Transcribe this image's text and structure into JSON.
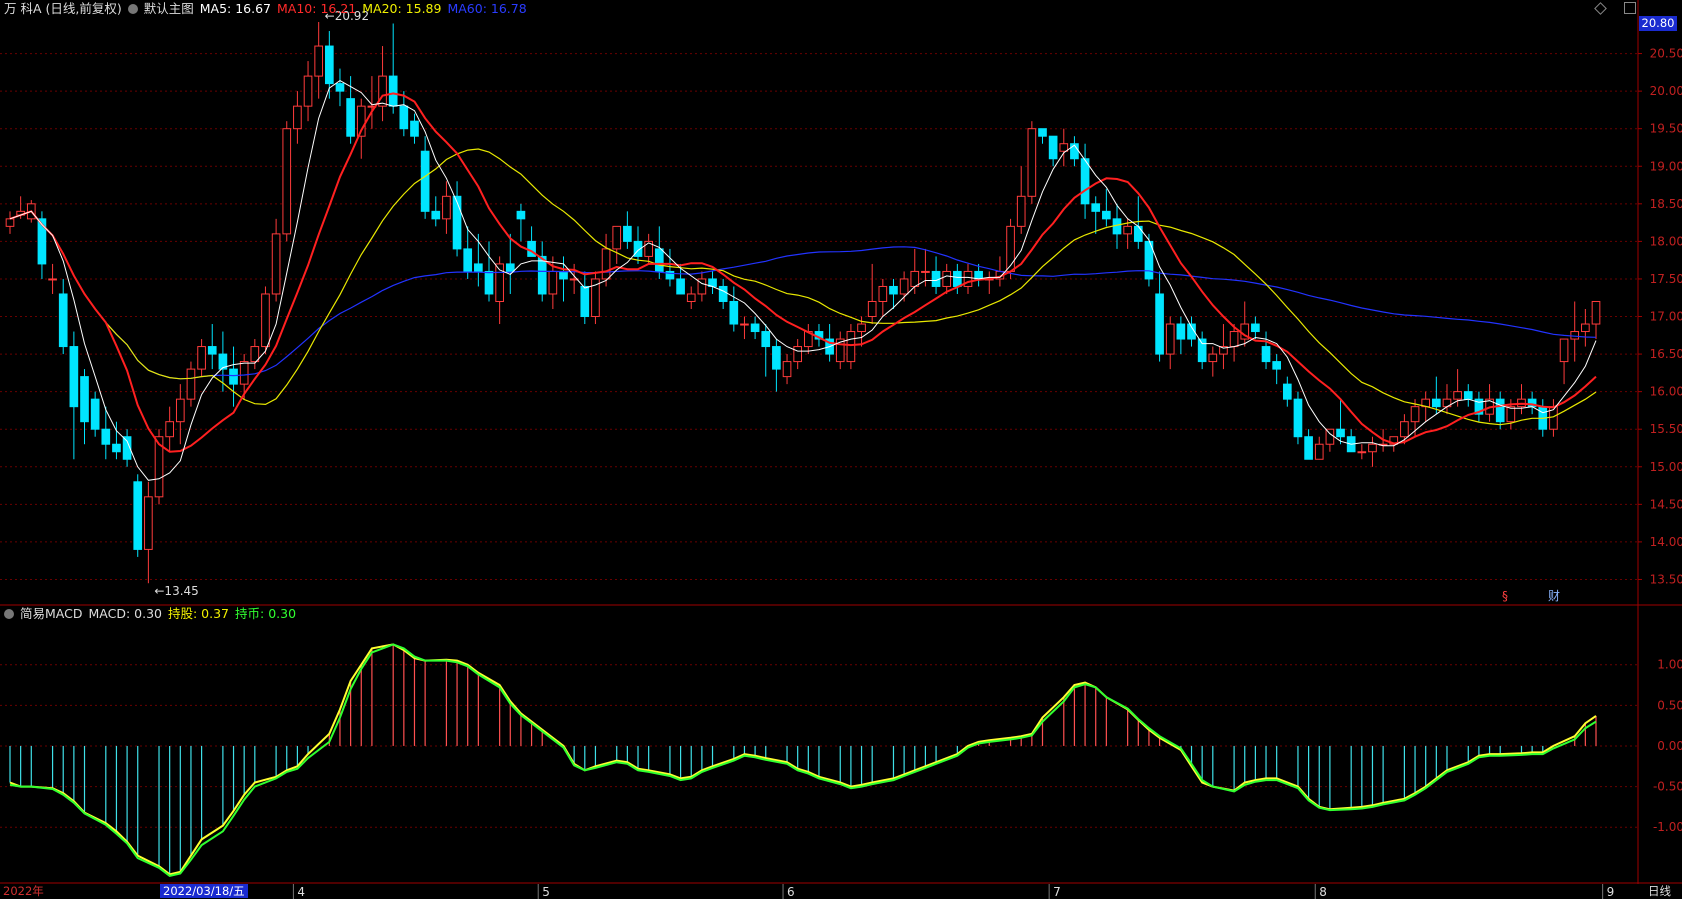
{
  "header": {
    "stock": "万 科A (日线,前复权)",
    "main_chart": "默认主图",
    "ma5": "MA5: 16.67",
    "ma10": "MA10: 16.21",
    "ma20": "MA20: 15.89",
    "ma60": "MA60: 16.78"
  },
  "macd_header": {
    "name": "简易MACD",
    "macd": "MACD: 0.30",
    "hold": "持股: 0.37",
    "coin": "持币: 0.30"
  },
  "price_box": "20.80",
  "selected_date": "2022/03/18/五",
  "year_label": "2022年",
  "period_label": "日线",
  "markers": {
    "s": "§",
    "cai": "财"
  },
  "colors": {
    "up": "#ff3b3b",
    "down": "#00e5ff",
    "ma5": "#ffffff",
    "ma10": "#ff2020",
    "ma20": "#e8e800",
    "ma60": "#2233ff",
    "macd_line": "#ffff30",
    "signal_line": "#30ff30",
    "axis": "#a00000",
    "grid": "#6a0000"
  },
  "chart_data": [
    {
      "type": "candlestick",
      "title": "万 科A (日线,前复权)",
      "ylim": [
        13.2,
        21.0
      ],
      "y_ticks": [
        13.5,
        14.0,
        14.5,
        15.0,
        15.5,
        16.0,
        16.5,
        17.0,
        17.5,
        18.0,
        18.5,
        19.0,
        19.5,
        20.0,
        20.5
      ],
      "y_tick_labels": [
        "13.50",
        "14.00",
        "14.50",
        "15.00",
        "15.50",
        "16.00",
        "16.50",
        "17.00",
        "17.50",
        "18.00",
        "18.50",
        "19.00",
        "19.50",
        "20.00",
        "20.50"
      ],
      "x_month_labels": [
        {
          "label": "4",
          "index": 27
        },
        {
          "label": "5",
          "index": 50
        },
        {
          "label": "6",
          "index": 73
        },
        {
          "label": "7",
          "index": 98
        },
        {
          "label": "8",
          "index": 123
        },
        {
          "label": "9",
          "index": 150
        }
      ],
      "annotations": [
        {
          "text": "20.92",
          "index": 29,
          "value": 20.92,
          "kind": "high"
        },
        {
          "text": "13.45",
          "index": 13,
          "value": 13.45,
          "kind": "low"
        }
      ],
      "ohlc": [
        [
          18.2,
          18.4,
          18.1,
          18.3
        ],
        [
          18.35,
          18.6,
          18.3,
          18.4
        ],
        [
          18.3,
          18.55,
          18.25,
          18.5
        ],
        [
          18.3,
          18.4,
          17.5,
          17.7
        ],
        [
          17.5,
          17.7,
          17.3,
          17.5
        ],
        [
          17.3,
          17.5,
          16.5,
          16.6
        ],
        [
          16.6,
          16.8,
          15.1,
          15.8
        ],
        [
          16.2,
          16.3,
          15.3,
          15.6
        ],
        [
          15.9,
          16.0,
          15.4,
          15.5
        ],
        [
          15.5,
          15.8,
          15.1,
          15.3
        ],
        [
          15.3,
          15.6,
          15.1,
          15.2
        ],
        [
          15.4,
          15.5,
          15.0,
          15.1
        ],
        [
          14.8,
          14.9,
          13.8,
          13.9
        ],
        [
          13.9,
          14.8,
          13.45,
          14.6
        ],
        [
          14.6,
          15.5,
          14.5,
          15.4
        ],
        [
          15.4,
          15.8,
          15.2,
          15.6
        ],
        [
          15.6,
          16.1,
          15.3,
          15.9
        ],
        [
          15.9,
          16.4,
          15.8,
          16.3
        ],
        [
          16.3,
          16.7,
          16.2,
          16.6
        ],
        [
          16.6,
          16.9,
          16.3,
          16.5
        ],
        [
          16.5,
          16.8,
          16.0,
          16.3
        ],
        [
          16.3,
          16.6,
          15.8,
          16.1
        ],
        [
          16.1,
          16.5,
          15.9,
          16.4
        ],
        [
          16.4,
          16.7,
          16.3,
          16.6
        ],
        [
          16.6,
          17.4,
          16.5,
          17.3
        ],
        [
          17.3,
          18.3,
          17.2,
          18.1
        ],
        [
          18.1,
          19.6,
          18.0,
          19.5
        ],
        [
          19.5,
          20.0,
          19.3,
          19.8
        ],
        [
          19.8,
          20.4,
          19.6,
          20.2
        ],
        [
          20.2,
          20.92,
          19.9,
          20.6
        ],
        [
          20.6,
          20.8,
          19.9,
          20.1
        ],
        [
          20.1,
          20.3,
          19.8,
          20.0
        ],
        [
          19.9,
          20.2,
          19.3,
          19.4
        ],
        [
          19.4,
          19.9,
          19.1,
          19.8
        ],
        [
          19.8,
          20.2,
          19.5,
          19.8
        ],
        [
          19.8,
          20.6,
          19.6,
          20.2
        ],
        [
          20.2,
          20.9,
          19.7,
          19.8
        ],
        [
          19.8,
          20.0,
          19.4,
          19.5
        ],
        [
          19.6,
          19.7,
          19.3,
          19.4
        ],
        [
          19.2,
          19.4,
          18.3,
          18.4
        ],
        [
          18.4,
          18.6,
          18.2,
          18.3
        ],
        [
          18.3,
          18.8,
          18.1,
          18.6
        ],
        [
          18.6,
          18.8,
          17.8,
          17.9
        ],
        [
          17.9,
          18.2,
          17.5,
          17.6
        ],
        [
          17.7,
          18.1,
          17.4,
          17.6
        ],
        [
          17.6,
          18.0,
          17.2,
          17.3
        ],
        [
          17.2,
          17.8,
          16.9,
          17.7
        ],
        [
          17.7,
          18.1,
          17.3,
          17.6
        ],
        [
          18.4,
          18.5,
          18.0,
          18.3
        ],
        [
          18.0,
          18.2,
          17.8,
          17.8
        ],
        [
          17.8,
          18.0,
          17.2,
          17.3
        ],
        [
          17.3,
          17.8,
          17.1,
          17.6
        ],
        [
          17.6,
          17.8,
          17.2,
          17.5
        ],
        [
          17.5,
          17.7,
          17.3,
          17.5
        ],
        [
          17.4,
          17.6,
          16.9,
          17.0
        ],
        [
          17.0,
          17.6,
          16.9,
          17.5
        ],
        [
          17.5,
          18.1,
          17.4,
          17.9
        ],
        [
          17.9,
          18.2,
          17.7,
          18.2
        ],
        [
          18.2,
          18.4,
          17.9,
          18.0
        ],
        [
          18.0,
          18.2,
          17.7,
          17.8
        ],
        [
          17.8,
          18.1,
          17.7,
          18.0
        ],
        [
          17.9,
          18.2,
          17.5,
          17.6
        ],
        [
          17.6,
          17.9,
          17.4,
          17.5
        ],
        [
          17.5,
          17.7,
          17.3,
          17.3
        ],
        [
          17.2,
          17.4,
          17.1,
          17.3
        ],
        [
          17.3,
          17.6,
          17.2,
          17.5
        ],
        [
          17.5,
          17.6,
          17.3,
          17.4
        ],
        [
          17.4,
          17.5,
          17.1,
          17.2
        ],
        [
          17.2,
          17.4,
          16.8,
          16.9
        ],
        [
          16.9,
          17.0,
          16.7,
          16.9
        ],
        [
          16.9,
          17.0,
          16.7,
          16.8
        ],
        [
          16.8,
          16.9,
          16.2,
          16.6
        ],
        [
          16.6,
          16.7,
          16.0,
          16.3
        ],
        [
          16.2,
          16.5,
          16.1,
          16.4
        ],
        [
          16.4,
          16.7,
          16.3,
          16.6
        ],
        [
          16.6,
          16.9,
          16.5,
          16.8
        ],
        [
          16.8,
          16.9,
          16.6,
          16.7
        ],
        [
          16.7,
          16.9,
          16.4,
          16.5
        ],
        [
          16.4,
          16.8,
          16.3,
          16.7
        ],
        [
          16.4,
          16.9,
          16.3,
          16.8
        ],
        [
          16.8,
          17.0,
          16.6,
          16.9
        ],
        [
          17.0,
          17.7,
          16.9,
          17.2
        ],
        [
          17.2,
          17.5,
          17.0,
          17.4
        ],
        [
          17.4,
          17.5,
          17.1,
          17.3
        ],
        [
          17.3,
          17.6,
          17.2,
          17.5
        ],
        [
          17.4,
          17.9,
          17.3,
          17.6
        ],
        [
          17.6,
          17.9,
          17.4,
          17.6
        ],
        [
          17.6,
          17.8,
          17.3,
          17.4
        ],
        [
          17.4,
          17.7,
          17.3,
          17.6
        ],
        [
          17.6,
          17.7,
          17.3,
          17.4
        ],
        [
          17.4,
          17.7,
          17.3,
          17.6
        ],
        [
          17.6,
          17.7,
          17.4,
          17.5
        ],
        [
          17.5,
          17.6,
          17.3,
          17.5
        ],
        [
          17.5,
          17.8,
          17.4,
          17.6
        ],
        [
          17.6,
          18.3,
          17.5,
          18.2
        ],
        [
          18.2,
          19.0,
          18.1,
          18.6
        ],
        [
          18.6,
          19.6,
          18.5,
          19.5
        ],
        [
          19.5,
          19.5,
          19.3,
          19.4
        ],
        [
          19.4,
          19.4,
          19.0,
          19.1
        ],
        [
          19.2,
          19.5,
          19.0,
          19.3
        ],
        [
          19.3,
          19.4,
          19.0,
          19.1
        ],
        [
          19.1,
          19.3,
          18.3,
          18.5
        ],
        [
          18.5,
          18.6,
          18.1,
          18.4
        ],
        [
          18.4,
          18.7,
          18.2,
          18.3
        ],
        [
          18.3,
          18.5,
          17.9,
          18.1
        ],
        [
          18.1,
          18.3,
          17.9,
          18.2
        ],
        [
          18.2,
          18.6,
          17.9,
          18.0
        ],
        [
          18.0,
          18.1,
          17.4,
          17.5
        ],
        [
          17.3,
          17.6,
          16.4,
          16.5
        ],
        [
          16.5,
          17.0,
          16.3,
          16.9
        ],
        [
          16.9,
          17.0,
          16.5,
          16.7
        ],
        [
          16.9,
          17.0,
          16.6,
          16.7
        ],
        [
          16.7,
          16.8,
          16.3,
          16.4
        ],
        [
          16.4,
          16.6,
          16.2,
          16.5
        ],
        [
          16.5,
          16.9,
          16.3,
          16.6
        ],
        [
          16.6,
          16.9,
          16.4,
          16.8
        ],
        [
          16.7,
          17.2,
          16.6,
          16.9
        ],
        [
          16.9,
          17.0,
          16.7,
          16.8
        ],
        [
          16.6,
          16.8,
          16.3,
          16.4
        ],
        [
          16.4,
          16.5,
          16.1,
          16.3
        ],
        [
          16.1,
          16.2,
          15.8,
          15.9
        ],
        [
          15.9,
          16.0,
          15.3,
          15.4
        ],
        [
          15.4,
          15.5,
          15.1,
          15.1
        ],
        [
          15.1,
          15.4,
          15.1,
          15.3
        ],
        [
          15.3,
          15.5,
          15.2,
          15.5
        ],
        [
          15.5,
          15.9,
          15.3,
          15.4
        ],
        [
          15.4,
          15.5,
          15.2,
          15.2
        ],
        [
          15.2,
          15.3,
          15.1,
          15.2
        ],
        [
          15.2,
          15.4,
          15.0,
          15.3
        ],
        [
          15.3,
          15.5,
          15.2,
          15.3
        ],
        [
          15.3,
          15.4,
          15.2,
          15.4
        ],
        [
          15.4,
          15.7,
          15.3,
          15.6
        ],
        [
          15.6,
          15.9,
          15.4,
          15.8
        ],
        [
          15.8,
          16.0,
          15.6,
          15.9
        ],
        [
          15.9,
          16.2,
          15.7,
          15.8
        ],
        [
          15.8,
          16.1,
          15.7,
          15.9
        ],
        [
          15.9,
          16.3,
          15.8,
          16.0
        ],
        [
          16.0,
          16.1,
          15.8,
          15.9
        ],
        [
          15.9,
          16.0,
          15.6,
          15.7
        ],
        [
          15.7,
          16.1,
          15.6,
          15.9
        ],
        [
          15.9,
          16.0,
          15.5,
          15.6
        ],
        [
          15.6,
          15.9,
          15.5,
          15.8
        ],
        [
          15.8,
          16.1,
          15.7,
          15.9
        ],
        [
          15.9,
          16.0,
          15.7,
          15.8
        ],
        [
          15.8,
          15.9,
          15.4,
          15.5
        ],
        [
          15.5,
          15.9,
          15.4,
          15.8
        ],
        [
          16.4,
          16.7,
          16.1,
          16.7
        ],
        [
          16.7,
          17.2,
          16.4,
          16.8
        ],
        [
          16.8,
          17.1,
          16.6,
          16.9
        ],
        [
          16.9,
          17.2,
          16.7,
          17.2
        ]
      ]
    },
    {
      "type": "line",
      "title": "简易MACD",
      "ylim": [
        -1.65,
        1.55
      ],
      "y_ticks": [
        -1.0,
        -0.5,
        0.0,
        0.5,
        1.0
      ],
      "y_tick_labels": [
        "-1.00",
        "-0.50",
        "0.00",
        "0.50",
        "1.00"
      ],
      "series": [
        {
          "name": "持股",
          "values": [
            -0.45,
            -0.5,
            -0.5,
            -0.52,
            -0.58,
            -0.68,
            -0.82,
            -0.95,
            -1.05,
            -1.18,
            -1.35,
            -1.48,
            -1.58,
            -1.55,
            -1.35,
            -1.15,
            -0.98,
            -0.8,
            -0.6,
            -0.45,
            -0.38,
            -0.3,
            -0.25,
            -0.1,
            0.15,
            0.45,
            0.8,
            1.0,
            1.2,
            1.25,
            1.18,
            1.08,
            1.05,
            1.06,
            1.05,
            1.0,
            0.9,
            0.75,
            0.55,
            0.4,
            0.3,
            0.2,
            0.0,
            -0.22,
            -0.3,
            -0.25,
            -0.18,
            -0.2,
            -0.28,
            -0.3,
            -0.35,
            -0.4,
            -0.38,
            -0.3,
            -0.25,
            -0.16,
            -0.1,
            -0.12,
            -0.15,
            -0.2,
            -0.28,
            -0.32,
            -0.38,
            -0.45,
            -0.5,
            -0.48,
            -0.45,
            -0.4,
            -0.35,
            -0.3,
            -0.25,
            -0.2,
            -0.1,
            0.0,
            0.05,
            0.07,
            0.1,
            0.12,
            0.15,
            0.35,
            0.6,
            0.75,
            0.78,
            0.72,
            0.6,
            0.45,
            0.32,
            0.2,
            0.1,
            -0.05,
            -0.25,
            -0.45,
            -0.5,
            -0.55,
            -0.45,
            -0.42,
            -0.4,
            -0.4,
            -0.5,
            -0.65,
            -0.75,
            -0.78,
            -0.76,
            -0.75,
            -0.73,
            -0.7,
            -0.65,
            -0.58,
            -0.5,
            -0.4,
            -0.3,
            -0.2,
            -0.12,
            -0.1,
            -0.1,
            -0.09,
            -0.08,
            -0.08,
            0.0,
            0.12,
            0.28,
            0.37
          ]
        },
        {
          "name": "持币",
          "values": [
            -0.48,
            -0.5,
            -0.5,
            -0.53,
            -0.6,
            -0.7,
            -0.83,
            -0.97,
            -1.08,
            -1.2,
            -1.38,
            -1.5,
            -1.6,
            -1.57,
            -1.4,
            -1.22,
            -1.05,
            -0.86,
            -0.66,
            -0.5,
            -0.4,
            -0.32,
            -0.28,
            -0.15,
            0.05,
            0.35,
            0.7,
            0.95,
            1.15,
            1.25,
            1.2,
            1.1,
            1.05,
            1.05,
            1.03,
            0.98,
            0.88,
            0.72,
            0.52,
            0.38,
            0.28,
            0.18,
            -0.02,
            -0.24,
            -0.3,
            -0.27,
            -0.2,
            -0.22,
            -0.3,
            -0.32,
            -0.37,
            -0.42,
            -0.4,
            -0.32,
            -0.27,
            -0.18,
            -0.12,
            -0.14,
            -0.17,
            -0.22,
            -0.3,
            -0.34,
            -0.4,
            -0.47,
            -0.52,
            -0.5,
            -0.47,
            -0.42,
            -0.37,
            -0.32,
            -0.27,
            -0.22,
            -0.12,
            -0.02,
            0.03,
            0.05,
            0.08,
            0.1,
            0.13,
            0.3,
            0.55,
            0.72,
            0.76,
            0.72,
            0.6,
            0.46,
            0.33,
            0.22,
            0.12,
            -0.03,
            -0.22,
            -0.42,
            -0.5,
            -0.56,
            -0.48,
            -0.44,
            -0.42,
            -0.42,
            -0.52,
            -0.67,
            -0.76,
            -0.79,
            -0.78,
            -0.77,
            -0.75,
            -0.72,
            -0.67,
            -0.6,
            -0.52,
            -0.42,
            -0.32,
            -0.22,
            -0.14,
            -0.12,
            -0.12,
            -0.11,
            -0.1,
            -0.1,
            -0.03,
            0.08,
            0.22,
            0.3
          ]
        }
      ]
    }
  ]
}
